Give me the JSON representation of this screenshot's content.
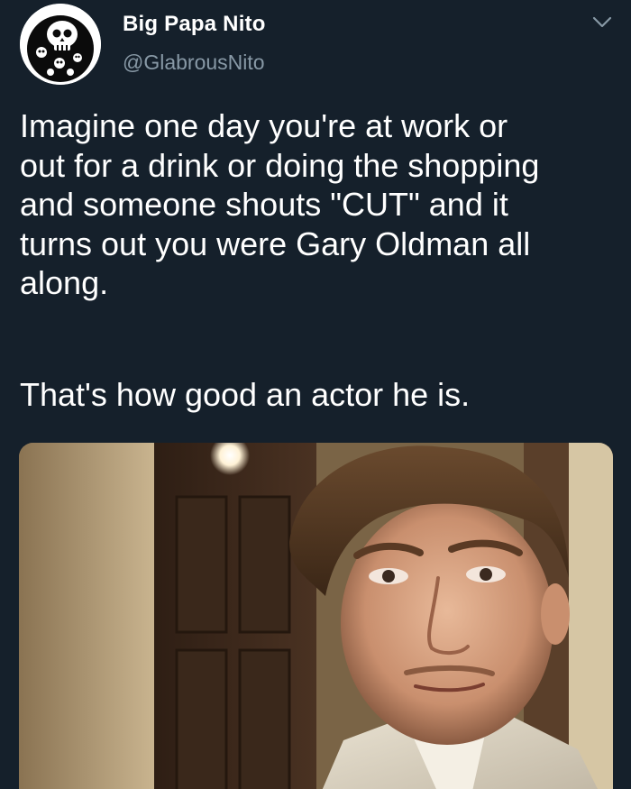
{
  "tweet": {
    "author": {
      "display_name": "Big Papa Nito",
      "handle": "@GlabrousNito",
      "avatar_icon": "skull-icon"
    },
    "more_icon": "chevron-down-icon",
    "text_paragraph_1": "Imagine one day you're at work or\nout for a drink or doing the shopping\nand someone shouts \"CUT\" and it\nturns out you were Gary Oldman all\nalong.",
    "text_paragraph_2": "That's how good an actor he is.",
    "media": {
      "type": "photo"
    }
  },
  "colors": {
    "background": "#15202b",
    "text_primary": "#ffffff",
    "text_secondary": "#8899a6"
  }
}
